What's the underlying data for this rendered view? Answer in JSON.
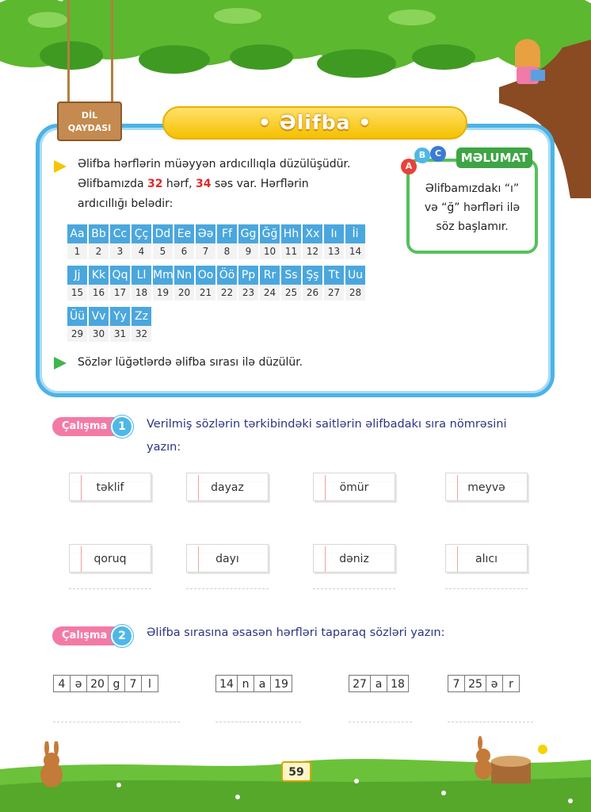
{
  "header": {
    "sign_line1": "DİL",
    "sign_line2": "QAYDASI",
    "title": "• Əlifba •"
  },
  "rule": {
    "line1": "Əlifba hərflərin müəyyən ardıcıllıqla düzülüşüdür.",
    "line2a": "Əlifbamızda ",
    "letters_count": "32",
    "line2b": " hərf, ",
    "sounds_count": "34",
    "line2c": " səs var. Hərflərin",
    "line3": "ardıcıllığı belədir:",
    "rule2": "Sözlər lüğətlərdə əlifba sırası ilə düzülür."
  },
  "alphabet_rows": [
    {
      "letters": [
        "Aa",
        "Bb",
        "Cc",
        "Çç",
        "Dd",
        "Ee",
        "Əə",
        "Ff",
        "Gg",
        "Ğğ",
        "Hh",
        "Xx",
        "Iı",
        "İi"
      ],
      "numbers": [
        "1",
        "2",
        "3",
        "4",
        "5",
        "6",
        "7",
        "8",
        "9",
        "10",
        "11",
        "12",
        "13",
        "14"
      ]
    },
    {
      "letters": [
        "Jj",
        "Kk",
        "Qq",
        "Ll",
        "Mm",
        "Nn",
        "Oo",
        "Öö",
        "Pp",
        "Rr",
        "Ss",
        "Şş",
        "Tt",
        "Uu"
      ],
      "numbers": [
        "15",
        "16",
        "17",
        "18",
        "19",
        "20",
        "21",
        "22",
        "23",
        "24",
        "25",
        "26",
        "27",
        "28"
      ]
    },
    {
      "letters": [
        "Üü",
        "Vv",
        "Yy",
        "Zz"
      ],
      "numbers": [
        "29",
        "30",
        "31",
        "32"
      ]
    }
  ],
  "info": {
    "abc": [
      "A",
      "B",
      "C"
    ],
    "tag": "MƏLUMAT",
    "line1": "Əlifbamızdakı “ı”",
    "line2": "və “ğ” hərfləri ilə",
    "line3": "söz başlamır."
  },
  "task1": {
    "label": "Çalışma",
    "number": "1",
    "text1": "Verilmiş sözlərin tərkibindəki saitlərin əlifbadakı sıra nömrəsini",
    "text2": "yazın:",
    "words": [
      "təklif",
      "dayaz",
      "ömür",
      "meyvə",
      "qoruq",
      "dayı",
      "dəniz",
      "alıcı"
    ]
  },
  "task2": {
    "label": "Çalışma",
    "number": "2",
    "text": "Əlifba sırasına əsasən hərfləri taparaq sözləri yazın:",
    "puzzles": [
      [
        "4",
        "ə",
        "20",
        "g",
        "7",
        "l"
      ],
      [
        "14",
        "n",
        "a",
        "19"
      ],
      [
        "27",
        "a",
        "18"
      ],
      [
        "7",
        "25",
        "ə",
        "r"
      ]
    ]
  },
  "footer": {
    "page_number": "59"
  },
  "colors": {
    "frame": "#4bb3e6",
    "title_yellow": "#f5c000",
    "info_green": "#3ea545",
    "alphabet_blue": "#4aa7de",
    "task_pink": "#f47aa6",
    "highlight_red": "#e02a2a"
  }
}
